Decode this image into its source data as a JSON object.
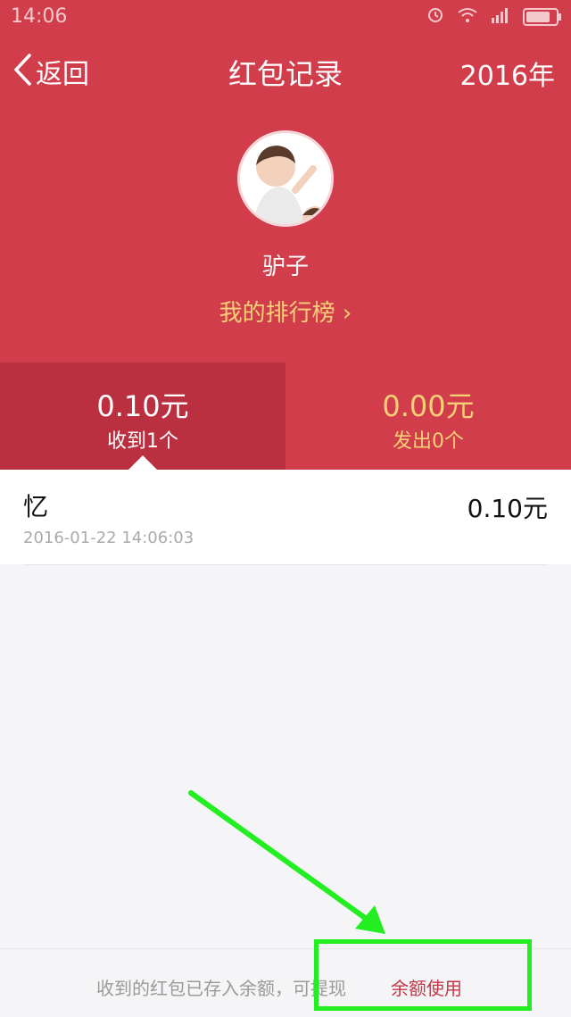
{
  "status_bar": {
    "time": "14:06",
    "icons": [
      "alarm-icon",
      "wifi-icon",
      "signal-icon",
      "battery-icon"
    ]
  },
  "header": {
    "back_label": "返回",
    "title": "红包记录",
    "year": "2016年"
  },
  "profile": {
    "username": "驴子",
    "ranking_label": "我的排行榜 ›"
  },
  "stats": {
    "received": {
      "amount": "0.10元",
      "count": "收到1个"
    },
    "sent": {
      "amount": "0.00元",
      "count": "发出0个"
    }
  },
  "records": [
    {
      "name": "忆",
      "date": "2016-01-22 14:06:03",
      "amount": "0.10元"
    }
  ],
  "footer": {
    "note": "收到的红包已存入余额，可提现",
    "link": "余额使用"
  },
  "colors": {
    "header_red": "#d13d4b",
    "active_tab": "#bb3040",
    "gold": "#f5d076",
    "highlight_green": "#22ee22"
  }
}
